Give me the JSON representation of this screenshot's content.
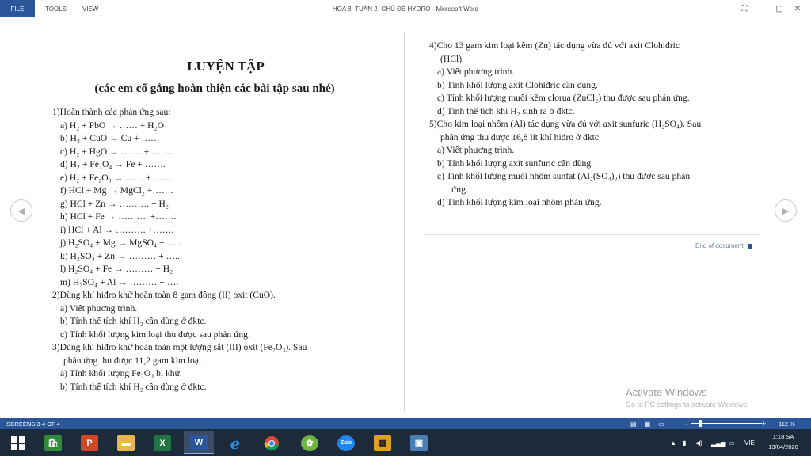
{
  "ribbon": {
    "file": "FILE",
    "tools": "TOOLS",
    "view": "VIEW"
  },
  "window": {
    "title": "HÓA 8- TUẦN 2- CHỦ ĐỀ HYDRO - Microsoft Word"
  },
  "left": {
    "title": "LUYỆN TẬP",
    "subtitle": "(các em cố gắng hoàn thiện các bài tập sau nhé)",
    "q1_title": "1)Hoàn thành các phản ứng sau:",
    "q1_items": [
      "a) H₂   +   PbO        →  …… +     H₂O",
      "b) H₂   +   CuO         →        Cu + ……",
      "c) H₂   +   HgO         → ……. + …….",
      "d) H₂   +   Fe₃O₄        → Fe  +  …….",
      "e) H₂   +   Fe₂O₃         → ……  +  …….",
      "f)  HCl   +  Mg   →   MgCl₂  +…….",
      "g) HCl   +  Zn   → ……….   + H₂",
      "h) HCl   +  Fe   → ……….   +…….",
      "i)  HCl   +  Al   → ……….   +…….",
      "j)  H₂SO₄   +   Mg   → MgSO₄  + …..",
      "k) H₂SO₄   +   Zn   → ………  + …..",
      "l)  H₂SO₄   +   Fe   → ………  +  H₂",
      "m) H₂SO₄   +   Al   → ………  + …."
    ],
    "q2_title": "2)Dùng khí hiđro khử hoàn toàn 8 gam đồng (II) oxit (CuO).",
    "q2_items": [
      "a) Viết phương trình.",
      "b) Tính thể tích khí H₂ cần dùng ở đktc.",
      "c) Tính khối lượng kim loại thu được sau phản ứng."
    ],
    "q3_title": "3)Dùng khí hiđro khử hoàn toàn một lượng sắt (III) oxit (Fe₂O₃). Sau",
    "q3_title_cont": "phản ứng thu được 11,2 gam kim loại.",
    "q3_items": [
      "a) Tính khối lượng Fe₂O₃ bị khử.",
      "b) Tính thể tích khí H₂ cần dùng ở đktc."
    ]
  },
  "right": {
    "q4_title": "4)Cho 13 gam kim loại kẽm (Zn) tác dụng vừa đủ với axit Clohiđric",
    "q4_title_cont": "(HCl).",
    "q4_items": [
      "a) Viết phương trình.",
      "b) Tính khối lượng axit Clohiđric cần dùng.",
      "c) Tính khối lượng muối kẽm clorua (ZnCl₂) thu được sau phản ứng.",
      "d) Tính thể tích khí H₂ sinh ra ở đktc."
    ],
    "q5_title": "5)Cho kim loại nhôm (Al) tác dụng vừa đủ với axit sunfuric (H₂SO₄). Sau",
    "q5_title_cont": "phản ứng thu được 16,8 lít khí hiđro ở đktc.",
    "q5_items": [
      "a) Viết phương trình.",
      "b) Tính khối lượng axit sunfuric cần dùng.",
      "c) Tính khối lượng muối nhôm sunfat (Al₂(SO₄)₃) thu được sau phản",
      "ứng.",
      "d) Tính khối lượng kim loại nhôm phản ứng."
    ],
    "end": "End of document"
  },
  "watermark": {
    "line1": "Activate Windows",
    "line2": "Go to PC settings to activate Windows."
  },
  "status": {
    "screens": "SCREENS 3-4 OF 4",
    "zoom": "112 %",
    "zoom_level": 0.12
  },
  "taskbar": {
    "apps": [
      "windows-start",
      "store",
      "powerpoint",
      "file-explorer",
      "excel",
      "word",
      "internet-explorer",
      "chrome",
      "coccoc",
      "zalo",
      "video-editor",
      "image-viewer"
    ],
    "lang": "VIE",
    "time": "1:18 SA",
    "date": "13/04/2020"
  }
}
